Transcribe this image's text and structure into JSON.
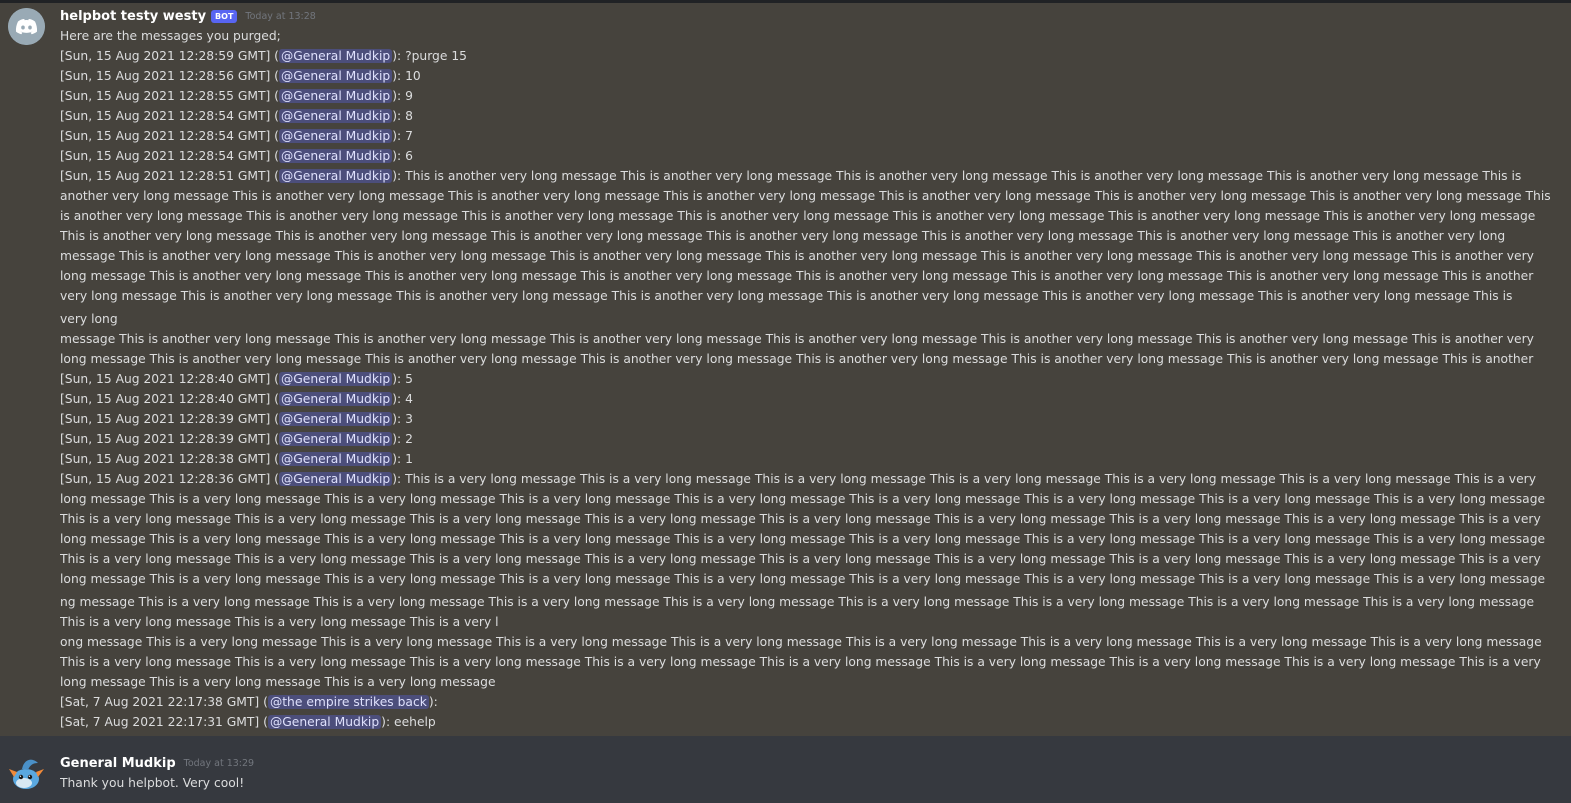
{
  "messages": [
    {
      "author": "helpbot testy westy",
      "bot_tag": "BOT",
      "timestamp": "Today at 13:28",
      "intro": "Here are the messages you purged;",
      "entries": [
        {
          "date": "[Sun, 15 Aug 2021 12:28:59 GMT] (",
          "mention": "@General Mudkip",
          "text": "): ?purge 15"
        },
        {
          "date": "[Sun, 15 Aug 2021 12:28:56 GMT] (",
          "mention": "@General Mudkip",
          "text": "): 10"
        },
        {
          "date": "[Sun, 15 Aug 2021 12:28:55 GMT] (",
          "mention": "@General Mudkip",
          "text": "): 9"
        },
        {
          "date": "[Sun, 15 Aug 2021 12:28:54 GMT] (",
          "mention": "@General Mudkip",
          "text": "): 8"
        },
        {
          "date": "[Sun, 15 Aug 2021 12:28:54 GMT] (",
          "mention": "@General Mudkip",
          "text": "): 7"
        },
        {
          "date": "[Sun, 15 Aug 2021 12:28:54 GMT] (",
          "mention": "@General Mudkip",
          "text": "): 6"
        },
        {
          "date": "[Sun, 15 Aug 2021 12:28:51 GMT] (",
          "mention": "@General Mudkip",
          "text": "): This is another very long message This is another very long message This is another very long message This is another very long message This is another very long message This is another very long message This is another very long message This is another very long message This is another very long message This is another very long message This is another very long message This is another very long message This is another very long message This is another very long message This is another very long message This is another very long message This is another very long message This is another very long message This is another very long message This is another very long message This is another very long message This is another very long message This is another very long message This is another very long message This is another very long message This is another very long message This is another very long message This is another very long message This is another very long message This is another very long message This is another very long message This is another very long message This is another very long message This is another very long message This is another very long message This is another very long message This is another very long message This is another very long message This is another very long message This is another very long message This is another very long message This is another very long message This is another very long message This is another very long message This is another very long message This is another very long message This is another very long message This is another very long message This is another very long message This is another"
        },
        {
          "plain": "very long"
        },
        {
          "plain": "message This is another very long message This is another very long message This is another very long message This is another very long message This is another very long message This is another very long message This is another very long message This is another very long message This is another very long message This is another very long message This is another very long message This is another very long message This is another very long message This is another very long message This is another very long me"
        },
        {
          "date": "[Sun, 15 Aug 2021 12:28:40 GMT] (",
          "mention": "@General Mudkip",
          "text": "): 5"
        },
        {
          "date": "[Sun, 15 Aug 2021 12:28:40 GMT] (",
          "mention": "@General Mudkip",
          "text": "): 4"
        },
        {
          "date": "[Sun, 15 Aug 2021 12:28:39 GMT] (",
          "mention": "@General Mudkip",
          "text": "): 3"
        },
        {
          "date": "[Sun, 15 Aug 2021 12:28:39 GMT] (",
          "mention": "@General Mudkip",
          "text": "): 2"
        },
        {
          "date": "[Sun, 15 Aug 2021 12:28:38 GMT] (",
          "mention": "@General Mudkip",
          "text": "): 1"
        },
        {
          "date": "[Sun, 15 Aug 2021 12:28:36 GMT] (",
          "mention": "@General Mudkip",
          "text": "): This is a very long message This is a very long message This is a very long message This is a very long message This is a very long message This is a very long message This is a very long message This is a very long message This is a very long message This is a very long message This is a very long message This is a very long message This is a very long message This is a very long message This is a very long message This is a very long message This is a very long message This is a very long message This is a very long message This is a very long message This is a very long message This is a very long message This is a very long message This is a very long message This is a very long message This is a very long message This is a very long message This is a very long message This is a very long message This is a very long message This is a very long message This is a very long message This is a very long message This is a very long message This is a very long message This is a very long message This is a very long message This is a very long message This is a very long message This is a very long message This is a very long message This is a very long message This is a very long message This is a very long message This is a very long message This is a very long message This is a very long message This is a very long message This is a very long message This is a very long message This is a very long message This is a very long message This is a very long message This is a very lo"
        },
        {
          "plain": "ng message This is a very long message This is a very long message This is a very long message This is a very long message This is a very long message This is a very long message This is a very long message This is a very long message This is a very long message This is a very long message This is a very l"
        },
        {
          "plain": "ong message This is a very long message This is a very long message This is a very long message This is a very long message This is a very long message This is a very long message This is a very long message This is a very long message This is a very long message This is a very long message This is a very long message This is a very long message This is a very long message This is a very long message This is a very long message This is a very long message This is a very long message This is a very long message This is a very long message"
        },
        {
          "date": "[Sat, 7 Aug 2021 22:17:38 GMT] (",
          "mention": "@the empire strikes back",
          "text": "):"
        },
        {
          "date": "[Sat, 7 Aug 2021 22:17:31 GMT] (",
          "mention": "@General Mudkip",
          "text": "): eehelp"
        }
      ]
    },
    {
      "author": "General Mudkip",
      "timestamp": "Today at 13:29",
      "text": "Thank you helpbot. Very cool!"
    }
  ],
  "colors": {
    "background": "#36393f",
    "highlight": "#46433d",
    "mention_bg": "#5865f2",
    "bot_tag": "#5865f2"
  },
  "icons": {
    "bot_avatar": "discord-logo-icon",
    "user_avatar": "mudkip-avatar-icon"
  }
}
